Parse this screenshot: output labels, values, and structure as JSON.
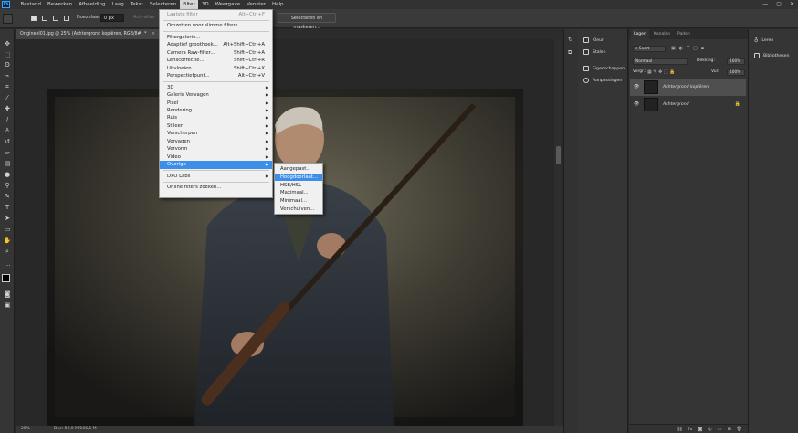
{
  "menubar": {
    "logo": "Ps",
    "items": [
      "Bestand",
      "Bewerken",
      "Afbeelding",
      "Laag",
      "Tekst",
      "Selecteren",
      "Filter",
      "3D",
      "Weergave",
      "Venster",
      "Help"
    ],
    "active": "Filter",
    "window_controls": [
      "—",
      "▢",
      "✕"
    ]
  },
  "options_bar": {
    "feather_label": "Doezelaar:",
    "feather_value": "0 px",
    "smooth_label": "Anti-alias",
    "select_button": "Selecteren en maskeren..."
  },
  "document": {
    "tab_title": "Origineel01.jpg @ 25% (Achtergrond kopiëren, RGB/8#) *",
    "close": "×",
    "zoom": "25%",
    "doc_info": "Doc: 52,9 M/106,1 M"
  },
  "filter_menu": {
    "items": [
      {
        "label": "Laatste filter",
        "shortcut": "Alt+Ctrl+F",
        "disabled": true
      },
      {
        "sep": true
      },
      {
        "label": "Omzetten voor slimme filters"
      },
      {
        "sep": true
      },
      {
        "label": "Filtergalerie..."
      },
      {
        "label": "Adaptief groothoek...",
        "shortcut": "Alt+Shift+Ctrl+A"
      },
      {
        "label": "Camera Raw-filter...",
        "shortcut": "Shift+Ctrl+A"
      },
      {
        "label": "Lenscorrectie...",
        "shortcut": "Shift+Ctrl+R"
      },
      {
        "label": "Uitvloeien...",
        "shortcut": "Shift+Ctrl+X"
      },
      {
        "label": "Perspectiefpunt...",
        "shortcut": "Alt+Ctrl+V"
      },
      {
        "sep": true
      },
      {
        "label": "3D",
        "submenu": true
      },
      {
        "label": "Galerie Vervagen",
        "submenu": true
      },
      {
        "label": "Pixel",
        "submenu": true
      },
      {
        "label": "Rendering",
        "submenu": true
      },
      {
        "label": "Ruis",
        "submenu": true
      },
      {
        "label": "Stileer",
        "submenu": true
      },
      {
        "label": "Verscherpen",
        "submenu": true
      },
      {
        "label": "Vervagen",
        "submenu": true
      },
      {
        "label": "Vervorm",
        "submenu": true
      },
      {
        "label": "Video",
        "submenu": true
      },
      {
        "label": "Overige",
        "submenu": true,
        "highlighted": true
      },
      {
        "sep": true
      },
      {
        "label": "DxO Labs",
        "submenu": true
      },
      {
        "sep": true
      },
      {
        "label": "Online filters zoeken..."
      }
    ]
  },
  "overige_submenu": {
    "items": [
      {
        "label": "Aangepast..."
      },
      {
        "label": "Hoogdoorlaat...",
        "highlighted": true
      },
      {
        "label": "HSB/HSL"
      },
      {
        "label": "Maximaal..."
      },
      {
        "label": "Minimaal..."
      },
      {
        "label": "Verschuiven..."
      }
    ]
  },
  "right_panels": {
    "col1": [
      "Kleur",
      "Stalen",
      "Eigenschappen",
      "Aanpassingen"
    ],
    "col2": [
      "Leren",
      "Bibliotheken"
    ]
  },
  "layers_panel": {
    "tabs": [
      "Lagen",
      "Kanalen",
      "Paden"
    ],
    "kind_filter": "Soort",
    "blend_mode": "Normaal",
    "opacity_label": "Dekking:",
    "opacity_value": "100%",
    "lock_label": "Vergr.:",
    "fill_label": "Vul:",
    "fill_value": "100%",
    "layers": [
      {
        "name": "Achtergrond kopiëren",
        "selected": true
      },
      {
        "name": "Achtergrond",
        "locked": true
      }
    ],
    "footer_icons": [
      "link-icon",
      "fx-icon",
      "mask-icon",
      "adjustment-icon",
      "group-icon",
      "new-layer-icon",
      "trash-icon"
    ]
  },
  "colors": {
    "menu_highlight": "#3d8ee8",
    "app_background": "#282828",
    "panel": "#353535"
  }
}
